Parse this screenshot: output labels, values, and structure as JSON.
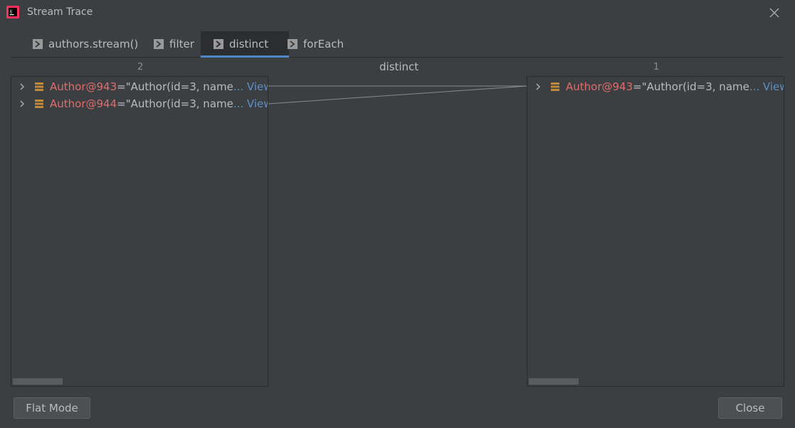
{
  "window": {
    "title": "Stream Trace"
  },
  "tabs": [
    {
      "label": "authors.stream()"
    },
    {
      "label": "filter"
    },
    {
      "label": "distinct"
    },
    {
      "label": "forEach"
    }
  ],
  "header": {
    "left_count": "2",
    "center_title": "distinct",
    "right_count": "1"
  },
  "left_panel": {
    "items": [
      {
        "name": "Author@943",
        "eq": " = ",
        "value": "\"Author(id=3, name",
        "more": "... View"
      },
      {
        "name": "Author@944",
        "eq": " = ",
        "value": "\"Author(id=3, name",
        "more": "... View"
      }
    ]
  },
  "right_panel": {
    "items": [
      {
        "name": "Author@943",
        "eq": " = ",
        "value": "\"Author(id=3, name",
        "more": "... View"
      }
    ]
  },
  "footer": {
    "flat_mode_label": "Flat Mode",
    "close_label": "Close"
  },
  "colors": {
    "background": "#3c3f41",
    "accent": "#4a88c7",
    "name": "#e06c6c",
    "link": "#5f8ec4",
    "field_icon": "#c08a3a"
  }
}
